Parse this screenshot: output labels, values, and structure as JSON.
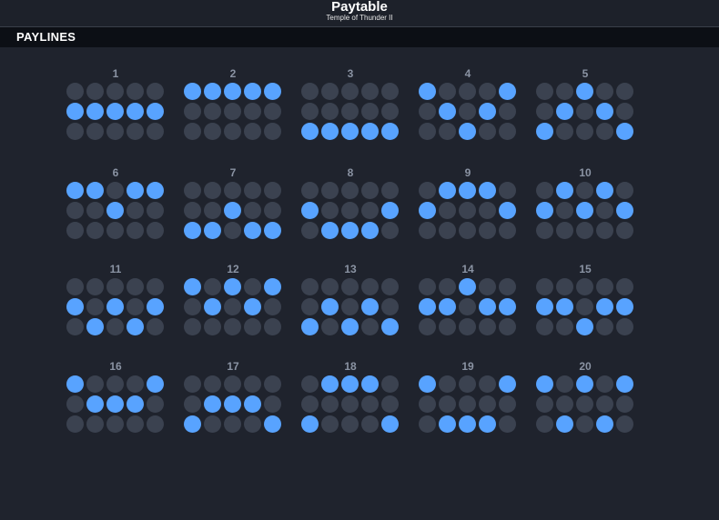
{
  "header": {
    "title": "Paytable",
    "subtitle": "Temple of Thunder II"
  },
  "section": {
    "title": "PAYLINES"
  },
  "colors": {
    "active": "#58a3ff",
    "inactive": "#3b4250",
    "background": "#1f232d",
    "bar": "#0c0f15",
    "number": "#8a93a3"
  },
  "paylines": [
    {
      "number": "1",
      "rows": [
        1,
        1,
        1,
        1,
        1
      ]
    },
    {
      "number": "2",
      "rows": [
        0,
        0,
        0,
        0,
        0
      ]
    },
    {
      "number": "3",
      "rows": [
        2,
        2,
        2,
        2,
        2
      ]
    },
    {
      "number": "4",
      "rows": [
        0,
        1,
        2,
        1,
        0
      ]
    },
    {
      "number": "5",
      "rows": [
        2,
        1,
        0,
        1,
        2
      ]
    },
    {
      "number": "6",
      "rows": [
        0,
        0,
        1,
        0,
        0
      ]
    },
    {
      "number": "7",
      "rows": [
        2,
        2,
        1,
        2,
        2
      ]
    },
    {
      "number": "8",
      "rows": [
        1,
        2,
        2,
        2,
        1
      ]
    },
    {
      "number": "9",
      "rows": [
        1,
        0,
        0,
        0,
        1
      ]
    },
    {
      "number": "10",
      "rows": [
        1,
        0,
        1,
        0,
        1
      ]
    },
    {
      "number": "11",
      "rows": [
        1,
        2,
        1,
        2,
        1
      ]
    },
    {
      "number": "12",
      "rows": [
        0,
        1,
        0,
        1,
        0
      ]
    },
    {
      "number": "13",
      "rows": [
        2,
        1,
        2,
        1,
        2
      ]
    },
    {
      "number": "14",
      "rows": [
        1,
        1,
        0,
        1,
        1
      ]
    },
    {
      "number": "15",
      "rows": [
        1,
        1,
        2,
        1,
        1
      ]
    },
    {
      "number": "16",
      "rows": [
        0,
        1,
        1,
        1,
        0
      ]
    },
    {
      "number": "17",
      "rows": [
        2,
        1,
        1,
        1,
        2
      ]
    },
    {
      "number": "18",
      "rows": [
        2,
        0,
        0,
        0,
        2
      ]
    },
    {
      "number": "19",
      "rows": [
        0,
        2,
        2,
        2,
        0
      ]
    },
    {
      "number": "20",
      "rows": [
        0,
        2,
        0,
        2,
        0
      ]
    }
  ]
}
